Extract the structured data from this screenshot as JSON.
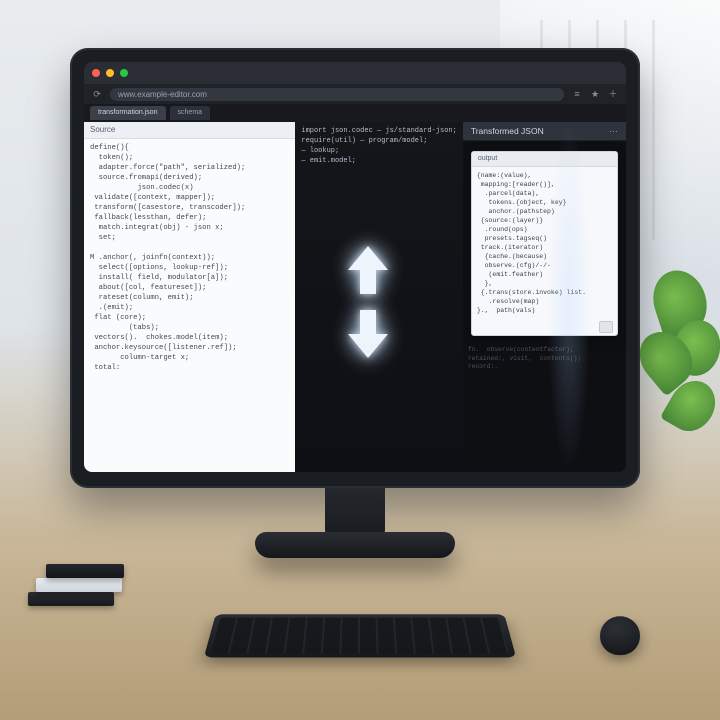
{
  "browser": {
    "url_placeholder": "www.example-editor.com",
    "traffic_light_colors": [
      "#ff5f57",
      "#febc2e",
      "#28c840"
    ],
    "toolbar_icons": [
      "menu",
      "star",
      "add"
    ]
  },
  "tabs": [
    {
      "label": "transformation.json",
      "active": true
    },
    {
      "label": "schema",
      "active": false
    }
  ],
  "left_pane": {
    "title": "Source",
    "code": "define(){\n  token();\n  adapter.force(\"path\", serialized);\n  source.fromapi(derived);\n           json.codec(x)\n validate([context, mapper]);\n transform([casestore, transcoder]);\n fallback(lessthan, defer);\n  match.integrat(obj) - json x;\n  set;\n\nM .anchor(, joinfn(context));\n  select([options, lookup-ref]);\n  install( field, modulator[a]);\n  about([col, featureset]);\n  rateset(column, emit);\n  .(emit);\n flat (core);\n         (tabs);\n vectors().  chokes.model(item);\n anchor.keysource([listener.ref]);\n       column-target x;\n total:"
  },
  "mid_top_code": "import json.codec — js/standard-json;\nrequire(util) — program/model;\n— lookup;\n— emit.model;\n",
  "right_pane": {
    "title": "Transformed JSON",
    "subheader": "output",
    "code": "{name:(value),\n mapping:[reader()],\n  .parcel(data),\n   tokens.{object, key}\n   anchor.(pathstep)\n {source:(layer)}\n  .round(ops)\n  presets.tagseq()\n track.(iterator)\n  {cache.(because)\n  observe.(cfg)/-/-\n   (emit.feather)\n  },\n {.trans(store.invoke) list.\n   .resolve(map)\n}.,  path(vals)\n",
    "bottom_code": "fn.  observe(contentfactor);\nretained:, visit,  contents();\nrecord:."
  },
  "arrows": {
    "up": "↑",
    "down": "↓"
  },
  "colors": {
    "bezel": "#1a1d22",
    "light_pane": "#fafbfc",
    "dark_pane": "#0d0f14",
    "highlight": "#f6d9a8"
  }
}
